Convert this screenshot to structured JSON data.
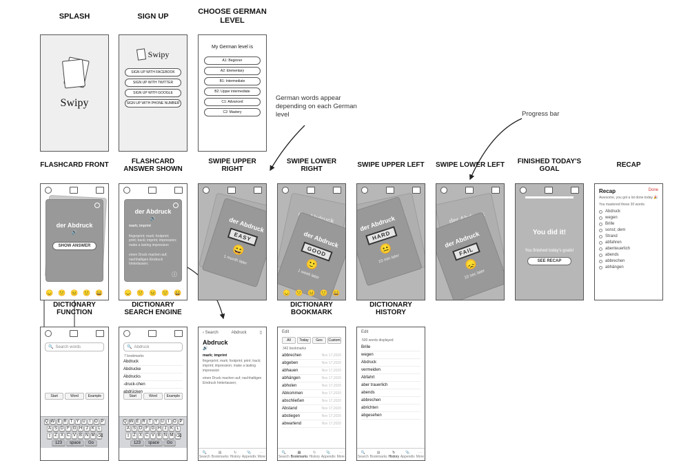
{
  "titles": {
    "splash": "SPLASH",
    "signup": "SIGN UP",
    "level": "CHOOSE GERMAN LEVEL",
    "ff": "FLASHCARD FRONT",
    "fa": "FLASHCARD ANSWER SHOWN",
    "sur": "SWIPE UPPER RIGHT",
    "slr": "SWIPE LOWER RIGHT",
    "sul": "SWIPE UPPER LEFT",
    "sll": "SWIPE LOWER LEFT",
    "fin": "FINISHED TODAY'S GOAL",
    "recap": "RECAP",
    "dfunc": "DICTIONARY FUNCTION",
    "dse": "DICTIONARY SEARCH ENGINE",
    "dbm": "DICTIONARY BOOKMARK",
    "dhist": "DICTIONARY HISTORY"
  },
  "brand": "Swipy",
  "signup": {
    "b1": "SIGN UP WITH FACEBOOK",
    "b2": "SIGN UP WITH TWITTER",
    "b3": "SIGN UP WITH GOOGLE",
    "b4": "SIGN UP WITH PHONE NUMBER"
  },
  "level": {
    "header": "My German level is",
    "a1": "A1: Beginner",
    "a2": "A2: Elementary",
    "b1": "B1: Intermediate",
    "b2": "B2: Upper intermediate",
    "c1": "C1: Advanced",
    "c2": "C2: Mastery"
  },
  "annot": {
    "words": "German words appear depending on each German level",
    "progress": "Progress bar"
  },
  "card": {
    "word": "der Abdruck",
    "show": "SHOW ANSWER",
    "pos": "mark; imprint",
    "def1": "fingerprint; mark; footprint; print; track; imprint; impression; make a lasting impression",
    "def2": "einen Druck machen auf; nachhaltigen Eindruck hinterlassen;"
  },
  "swipe": {
    "easy": "EASY",
    "easy_later": "1 month later",
    "good": "GOOD",
    "good_later": "1 week later",
    "hard": "HARD",
    "hard_later": "10 min later",
    "fail": "FAIL",
    "fail_later": "10 sec later"
  },
  "done": {
    "title": "You did it!",
    "sub": "You finished today's goals!",
    "btn": "SEE RECAP"
  },
  "recap": {
    "h": "Recap",
    "done": "Done",
    "sub": "Awesome, you got a lot done today 🎉",
    "sub2": "You mastered these 30 words",
    "w0": "Abdruck",
    "w1": "wegen",
    "w2": "Brille",
    "w3": "sonst; dem",
    "w4": "Strand",
    "w5": "abfahren",
    "w6": "abenteuerlich",
    "w7": "abends",
    "w8": "abbrechen",
    "w9": "abhängen"
  },
  "dict": {
    "searchPh": "Search words",
    "back": "Search",
    "crumb": "Abdruck",
    "edit": "Edit",
    "countBm": "342 bookmarks",
    "countHist": "500 words displayed",
    "tabs": {
      "all": "All",
      "today": "Today",
      "geo": "Geo",
      "custom": "Custom"
    },
    "seg": {
      "start": "Start",
      "word": "Word",
      "ex": "Example"
    },
    "nav": {
      "search": "Search",
      "bm": "Bookmarks",
      "hist": "History",
      "app": "Appendix",
      "more": "More"
    },
    "kbd": {
      "r1": [
        "Q",
        "W",
        "E",
        "R",
        "T",
        "Y",
        "U",
        "I",
        "O",
        "P"
      ],
      "r2": [
        "A",
        "S",
        "D",
        "F",
        "G",
        "H",
        "J",
        "K",
        "L"
      ],
      "r3": [
        "⇧",
        "Z",
        "X",
        "C",
        "V",
        "B",
        "N",
        "M",
        "⌫"
      ],
      "r4": [
        "123",
        "space",
        "Go"
      ]
    },
    "list1": [
      "Abdruck",
      "Abdrucke",
      "Abdrucks",
      "-druck-chen",
      "abdrücken"
    ],
    "listTyped": "7 bookmarks",
    "bm": [
      [
        "abbrechen",
        "Nov 17,2020"
      ],
      [
        "abgeben",
        "Nov 17,2020"
      ],
      [
        "abhauen",
        "Nov 17,2020"
      ],
      [
        "abhängen",
        "Nov 17,2020"
      ],
      [
        "abholen",
        "Nov 17,2020"
      ],
      [
        "Abkommen",
        "Nov 17,2020"
      ],
      [
        "abschließen",
        "Nov 17,2020"
      ],
      [
        "Abstand",
        "Nov 17,2020"
      ],
      [
        "abstiegen",
        "Nov 17,2020"
      ],
      [
        "abwartend",
        "Nov 17,2020"
      ]
    ],
    "hist": [
      "Brille",
      "wegen",
      "Abdruck",
      "vermeiden",
      "Abfahrt",
      "aber trauerlich",
      "abends",
      "abbrechen",
      "abrichten",
      "abgesehen"
    ]
  }
}
